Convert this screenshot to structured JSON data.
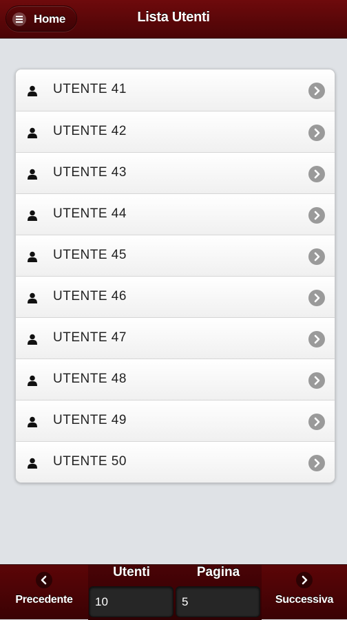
{
  "header": {
    "home_label": "Home",
    "title": "Lista Utenti",
    "menu_icon": "menu-icon"
  },
  "users": [
    {
      "name": "UTENTE 41"
    },
    {
      "name": "UTENTE 42"
    },
    {
      "name": "UTENTE 43"
    },
    {
      "name": "UTENTE 44"
    },
    {
      "name": "UTENTE 45"
    },
    {
      "name": "UTENTE 46"
    },
    {
      "name": "UTENTE 47"
    },
    {
      "name": "UTENTE 48"
    },
    {
      "name": "UTENTE 49"
    },
    {
      "name": "UTENTE 50"
    }
  ],
  "footer": {
    "prev_label": "Precedente",
    "next_label": "Successiva",
    "users_label": "Utenti",
    "page_label": "Pagina",
    "users_value": "10",
    "page_value": "5"
  },
  "colors": {
    "brand": "#6e0a0c",
    "background": "#dfe2e6"
  }
}
